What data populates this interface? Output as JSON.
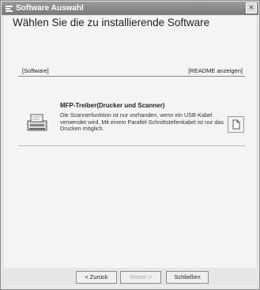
{
  "window": {
    "title": "Software Auswahl",
    "close_glyph": "×"
  },
  "heading": "Wählen Sie die zu installierende Software",
  "list_header": {
    "left": "[Software]",
    "right": "[README anzeigen]"
  },
  "item": {
    "icon": "printer-scanner-icon",
    "title": "MFP-Treiber(Drucker und Scanner)",
    "description": "Die Scannerfunktion ist nur vorhanden, wenn ein USB-Kabel verwendet wird. Mit einem Parallel-Schnittstellenkabel ist nur das Drucken möglich.",
    "readme_icon": "document-icon"
  },
  "buttons": {
    "back": "< Zurück",
    "next": "Weiter >",
    "close": "Schließen"
  },
  "colors": {
    "titlebar": "#8a8a8a",
    "background": "#f4f4f4",
    "disabled_text": "#a8a8a8"
  }
}
